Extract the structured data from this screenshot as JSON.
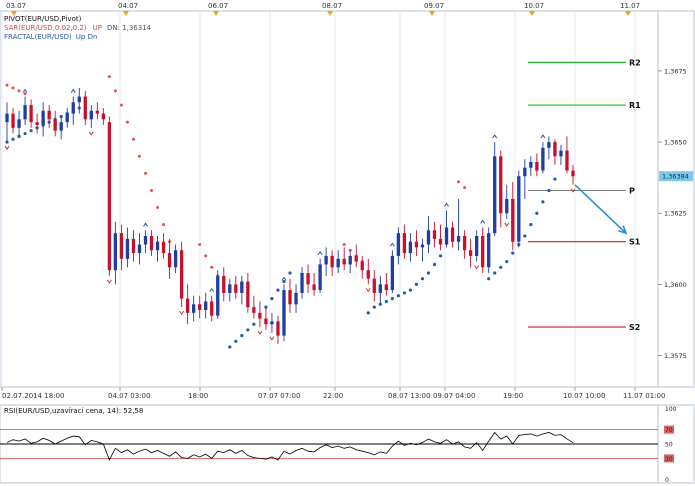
{
  "indicators": {
    "pivot_label": "PIVOT(EUR/USD,Pivot)",
    "sar_label": "SAR(EUR/USD,0.02,0.2)",
    "sar_state": "UP",
    "sar_dn": "DN: 1,36314",
    "fractal_label": "FRACTAL(EUR/USD)",
    "fractal_state": "Up  Dn"
  },
  "top_dates": [
    "03.07",
    "04.07",
    "06.07",
    "08.07",
    "09.07",
    "10.07",
    "11.07"
  ],
  "bottom_dates": [
    "02.07.2014 18:00",
    "04.07 03:00",
    "18:00",
    "07.07 07:00",
    "22:00",
    "08.07 13:00",
    "09.07 04:00",
    "19:00",
    "10.07 10:00",
    "11.07 01:00"
  ],
  "pivot_level_labels": [
    "R2",
    "R1",
    "P",
    "S1",
    "S2"
  ],
  "rsi_label": "RSI(EUR/USD,uzavírací cena, 14): 52,58",
  "rsi_ticks": [
    "100",
    "70",
    "50",
    "30",
    "0"
  ],
  "colors": {
    "bull": "#1f3f9f",
    "bear": "#c8102e",
    "sar_up": "#e4524c",
    "sar_down": "#1f5fa8",
    "r_lines": "#22bb22",
    "s_lines": "#cc2222",
    "arrow": "#2b8fce",
    "price_badge": "#7ec8ea"
  },
  "chart_data": {
    "type": "candlestick",
    "symbol": "EUR/USD",
    "ylim": [
      1.3565,
      1.3695
    ],
    "yticks": [
      1.3575,
      1.36,
      1.3625,
      1.365,
      1.3675
    ],
    "ytick_labels": [
      "1,3575",
      "1,3600",
      "1,3625",
      "1,3650",
      "1,3675"
    ],
    "last_price": 1.3638,
    "last_price_label": "1,36384",
    "pivot_levels": [
      {
        "name": "R2",
        "value": 1.3678
      },
      {
        "name": "R1",
        "value": 1.3663
      },
      {
        "name": "P",
        "value": 1.3633
      },
      {
        "name": "S1",
        "value": 1.3615
      },
      {
        "name": "S2",
        "value": 1.3585
      }
    ],
    "forecast_arrow": {
      "from": 1.3635,
      "to": 1.3618
    },
    "candles": [
      [
        1.3657,
        1.3664,
        1.365,
        1.366
      ],
      [
        1.366,
        1.3662,
        1.3653,
        1.3655
      ],
      [
        1.3655,
        1.3661,
        1.3652,
        1.3658
      ],
      [
        1.3658,
        1.3666,
        1.3656,
        1.3663
      ],
      [
        1.3663,
        1.3665,
        1.3655,
        1.3657
      ],
      [
        1.3657,
        1.366,
        1.3653,
        1.3656
      ],
      [
        1.3656,
        1.3664,
        1.3652,
        1.3661
      ],
      [
        1.3661,
        1.3663,
        1.3655,
        1.3658
      ],
      [
        1.3658,
        1.3661,
        1.3652,
        1.3654
      ],
      [
        1.3654,
        1.3659,
        1.3651,
        1.3657
      ],
      [
        1.3657,
        1.3662,
        1.3655,
        1.366
      ],
      [
        1.366,
        1.3666,
        1.3656,
        1.3664
      ],
      [
        1.3664,
        1.3669,
        1.366,
        1.3666
      ],
      [
        1.3666,
        1.3668,
        1.3656,
        1.3658
      ],
      [
        1.3658,
        1.3663,
        1.3655,
        1.3661
      ],
      [
        1.3661,
        1.3664,
        1.3658,
        1.366
      ],
      [
        1.366,
        1.3662,
        1.3656,
        1.3658
      ],
      [
        1.3657,
        1.3659,
        1.3603,
        1.3605
      ],
      [
        1.3605,
        1.3622,
        1.36,
        1.3618
      ],
      [
        1.3618,
        1.3621,
        1.3605,
        1.3609
      ],
      [
        1.3609,
        1.362,
        1.3606,
        1.3616
      ],
      [
        1.3616,
        1.3619,
        1.3608,
        1.3611
      ],
      [
        1.3611,
        1.3618,
        1.3607,
        1.3614
      ],
      [
        1.3614,
        1.3619,
        1.3611,
        1.3617
      ],
      [
        1.3617,
        1.3619,
        1.361,
        1.3612
      ],
      [
        1.3612,
        1.3617,
        1.3608,
        1.3615
      ],
      [
        1.3615,
        1.3618,
        1.3609,
        1.3611
      ],
      [
        1.3611,
        1.3616,
        1.3602,
        1.3606
      ],
      [
        1.3606,
        1.3614,
        1.3604,
        1.3612
      ],
      [
        1.3612,
        1.3615,
        1.3592,
        1.3595
      ],
      [
        1.3595,
        1.36,
        1.3586,
        1.359
      ],
      [
        1.359,
        1.3596,
        1.3587,
        1.3593
      ],
      [
        1.3593,
        1.3596,
        1.3588,
        1.3591
      ],
      [
        1.3591,
        1.3597,
        1.3588,
        1.3594
      ],
      [
        1.3594,
        1.3596,
        1.3587,
        1.3589
      ],
      [
        1.3589,
        1.3605,
        1.3588,
        1.3603
      ],
      [
        1.3603,
        1.3606,
        1.3594,
        1.3597
      ],
      [
        1.3597,
        1.3602,
        1.3594,
        1.36
      ],
      [
        1.36,
        1.3603,
        1.3595,
        1.3597
      ],
      [
        1.3597,
        1.3603,
        1.3593,
        1.3601
      ],
      [
        1.3601,
        1.3604,
        1.359,
        1.3592
      ],
      [
        1.3592,
        1.3596,
        1.3588,
        1.359
      ],
      [
        1.359,
        1.3594,
        1.3585,
        1.3588
      ],
      [
        1.3588,
        1.3592,
        1.3584,
        1.3586
      ],
      [
        1.3586,
        1.359,
        1.3583,
        1.3587
      ],
      [
        1.3587,
        1.3589,
        1.3579,
        1.3582
      ],
      [
        1.3582,
        1.36,
        1.358,
        1.3598
      ],
      [
        1.3598,
        1.3602,
        1.359,
        1.3593
      ],
      [
        1.3593,
        1.36,
        1.359,
        1.3597
      ],
      [
        1.3597,
        1.3606,
        1.3595,
        1.3604
      ],
      [
        1.3604,
        1.3607,
        1.3597,
        1.36
      ],
      [
        1.36,
        1.3604,
        1.3596,
        1.3598
      ],
      [
        1.3598,
        1.3609,
        1.3597,
        1.3607
      ],
      [
        1.3607,
        1.3613,
        1.3603,
        1.361
      ],
      [
        1.361,
        1.3612,
        1.3603,
        1.3606
      ],
      [
        1.3606,
        1.3612,
        1.3604,
        1.3609
      ],
      [
        1.3609,
        1.3613,
        1.3605,
        1.3607
      ],
      [
        1.3607,
        1.3612,
        1.3604,
        1.361
      ],
      [
        1.361,
        1.3614,
        1.3606,
        1.3608
      ],
      [
        1.3608,
        1.361,
        1.3602,
        1.3605
      ],
      [
        1.3605,
        1.3609,
        1.36,
        1.3602
      ],
      [
        1.3602,
        1.3605,
        1.3594,
        1.3597
      ],
      [
        1.3597,
        1.3603,
        1.3593,
        1.36
      ],
      [
        1.36,
        1.3604,
        1.3596,
        1.3598
      ],
      [
        1.3598,
        1.3612,
        1.3597,
        1.361
      ],
      [
        1.361,
        1.362,
        1.3607,
        1.3618
      ],
      [
        1.3618,
        1.3621,
        1.3609,
        1.3611
      ],
      [
        1.3611,
        1.3618,
        1.3608,
        1.3615
      ],
      [
        1.3615,
        1.3619,
        1.361,
        1.3613
      ],
      [
        1.3613,
        1.3616,
        1.3608,
        1.3614
      ],
      [
        1.3614,
        1.3624,
        1.3611,
        1.3619
      ],
      [
        1.3619,
        1.3622,
        1.3613,
        1.3616
      ],
      [
        1.3616,
        1.3621,
        1.3612,
        1.3614
      ],
      [
        1.3614,
        1.3626,
        1.3613,
        1.362
      ],
      [
        1.362,
        1.3622,
        1.3613,
        1.3615
      ],
      [
        1.3615,
        1.363,
        1.3612,
        1.3617
      ],
      [
        1.3617,
        1.3619,
        1.3609,
        1.3612
      ],
      [
        1.3612,
        1.3616,
        1.3606,
        1.361
      ],
      [
        1.361,
        1.3619,
        1.3608,
        1.3617
      ],
      [
        1.3617,
        1.362,
        1.3604,
        1.3606
      ],
      [
        1.3606,
        1.362,
        1.3604,
        1.3618
      ],
      [
        1.3618,
        1.365,
        1.3617,
        1.3645
      ],
      [
        1.3645,
        1.3647,
        1.362,
        1.3625
      ],
      [
        1.3625,
        1.3635,
        1.3623,
        1.363
      ],
      [
        1.363,
        1.3636,
        1.3612,
        1.3615
      ],
      [
        1.3615,
        1.364,
        1.3613,
        1.3638
      ],
      [
        1.3638,
        1.3644,
        1.363,
        1.3641
      ],
      [
        1.3641,
        1.3645,
        1.3638,
        1.3643
      ],
      [
        1.3643,
        1.3646,
        1.3638,
        1.364
      ],
      [
        1.364,
        1.365,
        1.3639,
        1.3648
      ],
      [
        1.3648,
        1.3652,
        1.3644,
        1.365
      ],
      [
        1.365,
        1.3651,
        1.3642,
        1.3645
      ],
      [
        1.3645,
        1.3649,
        1.3642,
        1.3647
      ],
      [
        1.3647,
        1.3652,
        1.3639,
        1.364
      ],
      [
        1.364,
        1.3642,
        1.3635,
        1.3638
      ]
    ],
    "rsi": [
      52,
      56,
      54,
      57,
      51,
      53,
      58,
      55,
      50,
      54,
      58,
      61,
      60,
      49,
      55,
      53,
      50,
      28,
      44,
      38,
      42,
      36,
      40,
      43,
      38,
      41,
      37,
      33,
      39,
      31,
      30,
      35,
      32,
      36,
      30,
      40,
      38,
      42,
      37,
      41,
      34,
      31,
      30,
      29,
      32,
      28,
      40,
      36,
      41,
      44,
      40,
      39,
      45,
      49,
      45,
      47,
      44,
      46,
      42,
      40,
      38,
      35,
      39,
      37,
      47,
      54,
      48,
      51,
      49,
      52,
      57,
      53,
      51,
      56,
      50,
      53,
      46,
      44,
      52,
      41,
      54,
      66,
      57,
      61,
      50,
      62,
      63,
      64,
      61,
      64,
      66,
      62,
      63,
      57,
      52
    ],
    "sar_up": [
      [
        0,
        1.367
      ],
      [
        1,
        1.3669
      ],
      [
        2,
        1.3668
      ],
      [
        3,
        1.3667
      ],
      [
        17,
        1.3673
      ],
      [
        18,
        1.3668
      ],
      [
        19,
        1.3663
      ],
      [
        20,
        1.3657
      ],
      [
        21,
        1.3651
      ],
      [
        22,
        1.3645
      ],
      [
        23,
        1.3639
      ],
      [
        24,
        1.3633
      ],
      [
        25,
        1.3627
      ],
      [
        26,
        1.3621
      ],
      [
        27,
        1.3615
      ],
      [
        28,
        1.361
      ],
      [
        29,
        1.3605
      ],
      [
        32,
        1.3614
      ],
      [
        33,
        1.361
      ],
      [
        34,
        1.3606
      ],
      [
        35,
        1.3603
      ],
      [
        36,
        1.36
      ],
      [
        56,
        1.3614
      ],
      [
        57,
        1.3612
      ],
      [
        58,
        1.361
      ],
      [
        59,
        1.3608
      ],
      [
        75,
        1.3636
      ],
      [
        76,
        1.3634
      ]
    ],
    "sar_down": [
      [
        0,
        1.365
      ],
      [
        1,
        1.3651
      ],
      [
        2,
        1.3652
      ],
      [
        3,
        1.3653
      ],
      [
        4,
        1.3654
      ],
      [
        5,
        1.3655
      ],
      [
        6,
        1.3656
      ],
      [
        7,
        1.3657
      ],
      [
        8,
        1.3658
      ],
      [
        9,
        1.3659
      ],
      [
        10,
        1.366
      ],
      [
        11,
        1.3661
      ],
      [
        12,
        1.3662
      ],
      [
        37,
        1.3578
      ],
      [
        38,
        1.358
      ],
      [
        39,
        1.3582
      ],
      [
        40,
        1.3584
      ],
      [
        41,
        1.3586
      ],
      [
        42,
        1.3589
      ],
      [
        43,
        1.3592
      ],
      [
        44,
        1.3595
      ],
      [
        45,
        1.3598
      ],
      [
        46,
        1.3601
      ],
      [
        47,
        1.3604
      ],
      [
        60,
        1.359
      ],
      [
        61,
        1.3592
      ],
      [
        62,
        1.3593
      ],
      [
        63,
        1.3594
      ],
      [
        64,
        1.3595
      ],
      [
        65,
        1.3596
      ],
      [
        66,
        1.3597
      ],
      [
        67,
        1.3598
      ],
      [
        68,
        1.36
      ],
      [
        69,
        1.3602
      ],
      [
        70,
        1.3604
      ],
      [
        71,
        1.3607
      ],
      [
        72,
        1.361
      ],
      [
        80,
        1.3602
      ],
      [
        81,
        1.3604
      ],
      [
        82,
        1.3606
      ],
      [
        83,
        1.3608
      ],
      [
        84,
        1.3611
      ],
      [
        85,
        1.3614
      ],
      [
        86,
        1.3617
      ],
      [
        87,
        1.3621
      ],
      [
        88,
        1.3625
      ],
      [
        89,
        1.3629
      ],
      [
        90,
        1.3633
      ],
      [
        91,
        1.3637
      ]
    ],
    "fractals_up": [
      3,
      11,
      23,
      34,
      46,
      52,
      64,
      73,
      79,
      81,
      89
    ],
    "fractals_down": [
      0,
      14,
      17,
      29,
      42,
      44,
      60,
      78,
      83,
      94
    ]
  }
}
